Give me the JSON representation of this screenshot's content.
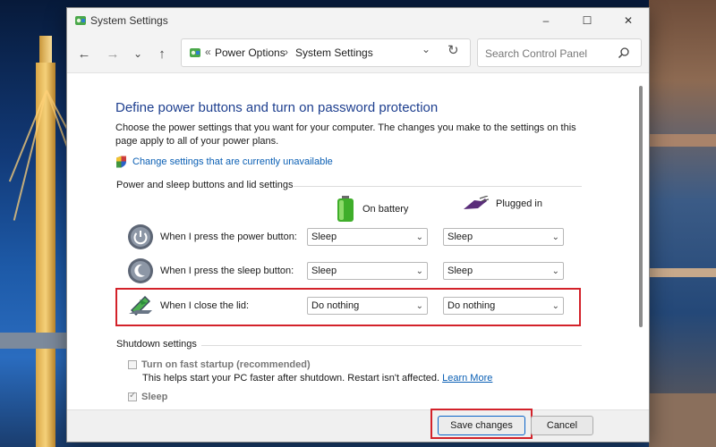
{
  "window": {
    "title": "System Settings",
    "minimize_glyph": "–",
    "maximize_glyph": "☐",
    "close_glyph": "✕"
  },
  "nav": {
    "back_glyph": "←",
    "forward_glyph": "→",
    "recent_glyph": "⌄",
    "up_glyph": "↑",
    "breadcrumb": [
      "Power Options",
      "System Settings"
    ],
    "prefix_glyph": "«",
    "separator_glyph": "›",
    "dropdown_glyph": "⌄",
    "refresh_glyph": "↻",
    "search_placeholder": "Search Control Panel"
  },
  "main": {
    "heading": "Define power buttons and turn on password protection",
    "description": "Choose the power settings that you want for your computer. The changes you make to the settings on this page apply to all of your power plans.",
    "change_link": "Change settings that are currently unavailable",
    "power_group_label": "Power and sleep buttons and lid settings",
    "columns": {
      "battery": "On battery",
      "plugged": "Plugged in"
    },
    "rows": [
      {
        "label": "When I press the power button:",
        "battery": "Sleep",
        "plugged": "Sleep",
        "icon": "power-icon"
      },
      {
        "label": "When I press the sleep button:",
        "battery": "Sleep",
        "plugged": "Sleep",
        "icon": "sleep-icon"
      },
      {
        "label": "When I close the lid:",
        "battery": "Do nothing",
        "plugged": "Do nothing",
        "icon": "laptop-lid-icon",
        "highlighted": true
      }
    ],
    "shutdown_label": "Shutdown settings",
    "fast_startup": {
      "label": "Turn on fast startup (recommended)",
      "checked": false,
      "description": "This helps start your PC faster after shutdown. Restart isn't affected.",
      "learn_more": "Learn More"
    },
    "sleep_option": {
      "label": "Sleep",
      "checked": true
    }
  },
  "footer": {
    "save_label": "Save changes",
    "cancel_label": "Cancel"
  },
  "colors": {
    "heading": "#1e3f8f",
    "link": "#0a5fb4",
    "highlight": "#d3222a",
    "battery_green": "#3fae2a"
  }
}
